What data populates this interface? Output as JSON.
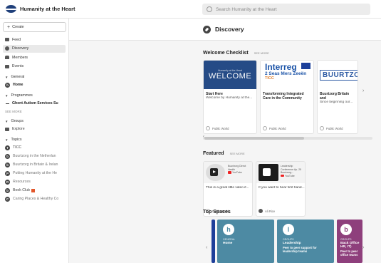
{
  "app": {
    "title": "Humanity at the Heart",
    "search_placeholder": "Search Humanity at the Heart"
  },
  "sidebar": {
    "create_label": "Create",
    "nav": [
      {
        "label": "Feed",
        "icon": "feed-icon"
      },
      {
        "label": "Discovery",
        "icon": "compass-icon"
      },
      {
        "label": "Members",
        "icon": "members-icon"
      },
      {
        "label": "Events",
        "icon": "calendar-icon"
      }
    ],
    "general": {
      "heading": "General",
      "items": [
        {
          "label": "Home",
          "avatar": "h"
        }
      ]
    },
    "programmes": {
      "heading": "Programmes",
      "items": [
        {
          "label": "Ghent Autism Services Su"
        }
      ],
      "see_more": "SEE MORE"
    },
    "groups": {
      "heading": "Groups",
      "items": [
        {
          "label": "Explore"
        }
      ]
    },
    "topics": {
      "heading": "Topics",
      "items": [
        {
          "label": "TICC",
          "avatar": "T"
        },
        {
          "label": "Buurtzorg in the Netherlan",
          "avatar": "b"
        },
        {
          "label": "Buurtzorg in Britain & Irelan",
          "avatar": "b"
        },
        {
          "label": "Putting Humanity at the He",
          "avatar": "P"
        },
        {
          "label": "Resources",
          "avatar": "R"
        },
        {
          "label": "Book Club",
          "avatar": "b"
        },
        {
          "label": "Caring Places & Healthy Co",
          "avatar": "C"
        }
      ]
    }
  },
  "page": {
    "title": "Discovery"
  },
  "welcome": {
    "title": "Welcome Checklist",
    "see_more": "SEE MORE",
    "cards": [
      {
        "hero_small": "Humanity at the Heart",
        "hero_big": "WELCOME",
        "title": "Start Here",
        "sub": "Welcome by Humanity at the...",
        "foot": "Public World"
      },
      {
        "hero_big": "Interreg",
        "hero_line2": "2 Seas Mers Zeeën",
        "hero_line3": "TICC",
        "title": "Transforming Integrated Care in the Community",
        "sub": "",
        "foot": "Public World"
      },
      {
        "hero_big": "BUURTZO",
        "title": "Buurtzorg Britain and",
        "sub": "Since beginning our...",
        "foot": "Public World"
      }
    ]
  },
  "featured": {
    "title": "Featured",
    "see_more": "SEE MORE",
    "cards": [
      {
        "meta": "Buurtzorg Direct Health",
        "yt": "YouTube",
        "title": "This is a great little video if...",
        "foot": "Public World"
      },
      {
        "meta": "Leadership Conference Ap. 25 Buurtzorg...",
        "yt": "YouTube",
        "title": "If you want to hear first hand...",
        "foot": "Ali Rice"
      }
    ]
  },
  "top_spaces": {
    "title": "Top Spaces",
    "cards": [
      {
        "avatar": "h",
        "type": "GENERAL",
        "name": "Home",
        "desc": ""
      },
      {
        "avatar": "l",
        "type": "GROUPS",
        "name": "Leadership",
        "desc": "Peer to peer support for leadership teams"
      },
      {
        "avatar": "b",
        "type": "GROUPS",
        "name": "Back Office HR, IT)",
        "desc": "Peer to peer office teams"
      }
    ]
  },
  "colors": {
    "welcome_blue": "#254b86",
    "space_teal": "#4d8aa3",
    "space_purple": "#8e3f7c",
    "accent_navy": "#1f3f7a"
  }
}
